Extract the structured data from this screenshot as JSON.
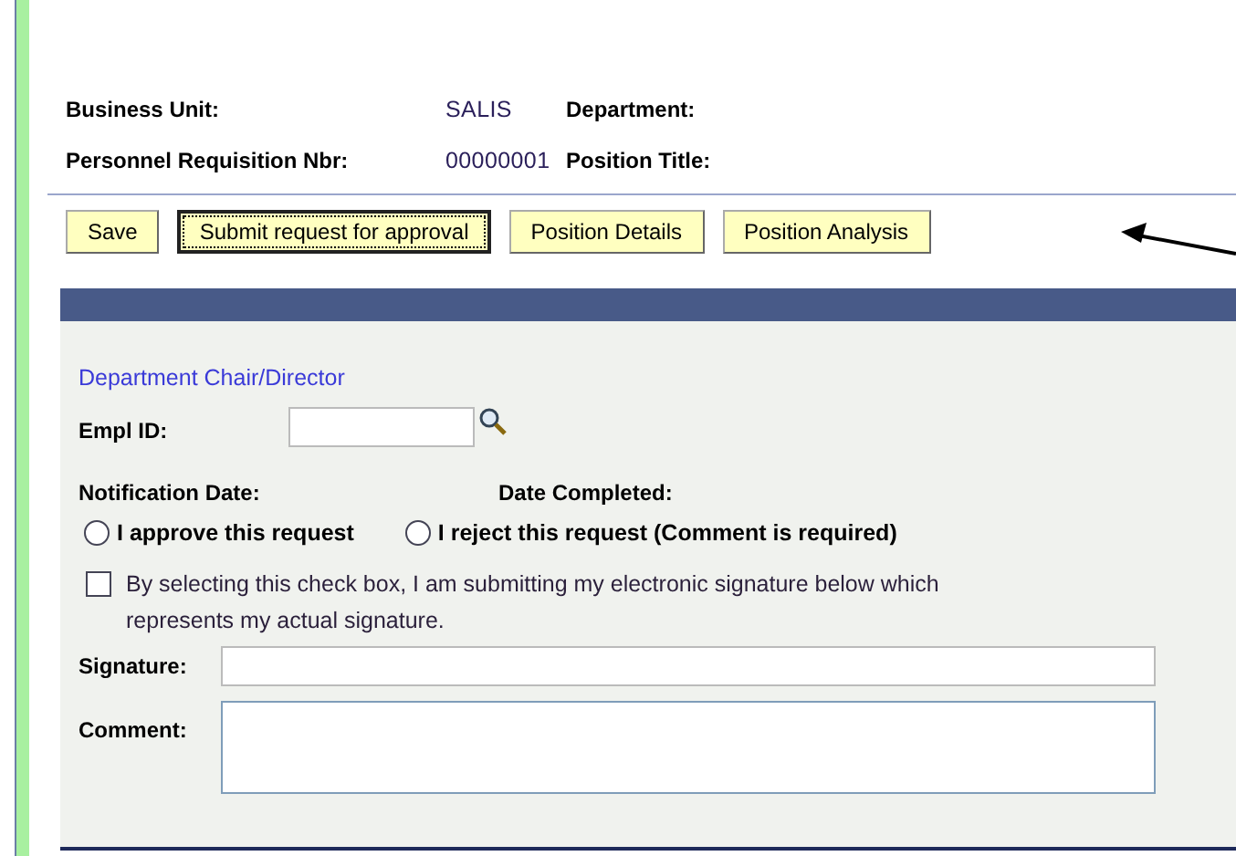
{
  "header": [
    {
      "label": "Business Unit:",
      "value": "SALIS",
      "label_2": "Department:"
    },
    {
      "label": "Personnel Requisition Nbr:",
      "value": "00000001",
      "label_2": "Position Title:"
    }
  ],
  "buttons": [
    {
      "label": "Save",
      "focused": false
    },
    {
      "label": "Submit request for approval",
      "focused": true
    },
    {
      "label": "Position Details",
      "focused": false
    },
    {
      "label": "Position Analysis",
      "focused": false
    }
  ],
  "section": {
    "title": "Department Chair/Director",
    "empl_id": {
      "label": "Empl ID:"
    },
    "notification_date": "Notification Date:",
    "date_completed": "Date Completed:",
    "radios": [
      {
        "label": "I approve this request",
        "selected": false
      },
      {
        "label": "I reject this request (Comment is required)",
        "selected": false
      }
    ],
    "signature_checkbox": {
      "label": "By selecting this check box, I am submitting my electronic signature below which represents my actual signature.",
      "checked": false
    },
    "signature": {
      "label": "Signature:"
    },
    "comment": {
      "label": "Comment:"
    }
  }
}
